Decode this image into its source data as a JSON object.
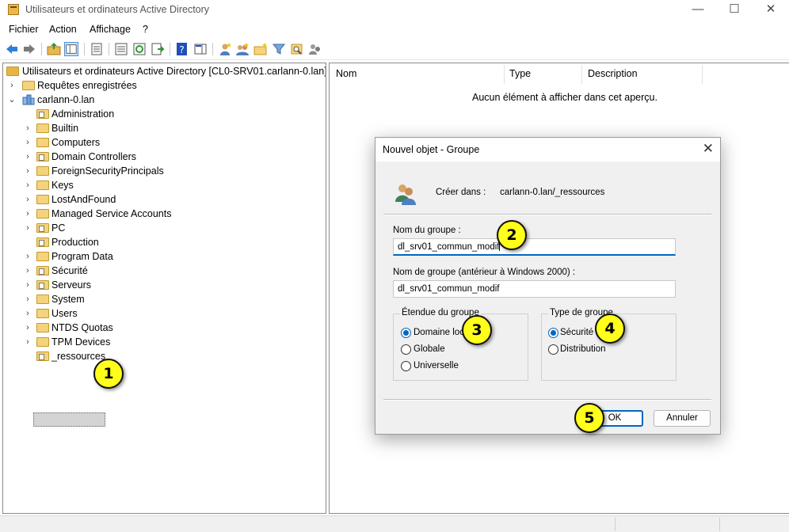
{
  "window": {
    "title": "Utilisateurs et ordinateurs Active Directory",
    "minimize": "—",
    "maximize": "☐",
    "close": "✕"
  },
  "menu": [
    "Fichier",
    "Action",
    "Affichage",
    "?"
  ],
  "toolbar": {
    "icons": [
      "back-arrow",
      "forward-arrow",
      "up-folder",
      "show-hide-console-tree",
      "properties",
      "export-list",
      "refresh",
      "export",
      "help",
      "show-hide-action-pane",
      "new-user",
      "new-group",
      "new-ou",
      "filter",
      "find",
      "delegate"
    ]
  },
  "tree": {
    "root": "Utilisateurs et ordinateurs Active Directory [CL0-SRV01.carlann-0.lan]",
    "saved_queries": "Requêtes enregistrées",
    "domain": "carlann-0.lan",
    "children": [
      "Administration",
      "Builtin",
      "Computers",
      "Domain Controllers",
      "ForeignSecurityPrincipals",
      "Keys",
      "LostAndFound",
      "Managed Service Accounts",
      "PC",
      "Production",
      "Program Data",
      "Sécurité",
      "Serveurs",
      "System",
      "Users",
      "NTDS Quotas",
      "TPM Devices",
      "_ressources"
    ]
  },
  "details": {
    "columns": [
      "Nom",
      "Type",
      "Description"
    ],
    "empty_message": "Aucun élément à afficher dans cet aperçu."
  },
  "dialog": {
    "title": "Nouvel objet - Groupe",
    "create_in_label": "Créer dans :",
    "create_in_value": "carlann-0.lan/_ressources",
    "group_name_label": "Nom du groupe :",
    "group_name_value": "dl_srv01_commun_modif",
    "pre2000_label": "Nom de groupe (antérieur à Windows 2000) :",
    "pre2000_value": "dl_srv01_commun_modif",
    "scope": {
      "title": "Étendue du groupe",
      "options": [
        "Domaine local",
        "Globale",
        "Universelle"
      ],
      "selected": "Domaine local"
    },
    "type": {
      "title": "Type de groupe",
      "options": [
        "Sécurité",
        "Distribution"
      ],
      "selected": "Sécurité"
    },
    "ok": "OK",
    "cancel": "Annuler"
  },
  "callouts": [
    "1",
    "2",
    "3",
    "4",
    "5"
  ]
}
